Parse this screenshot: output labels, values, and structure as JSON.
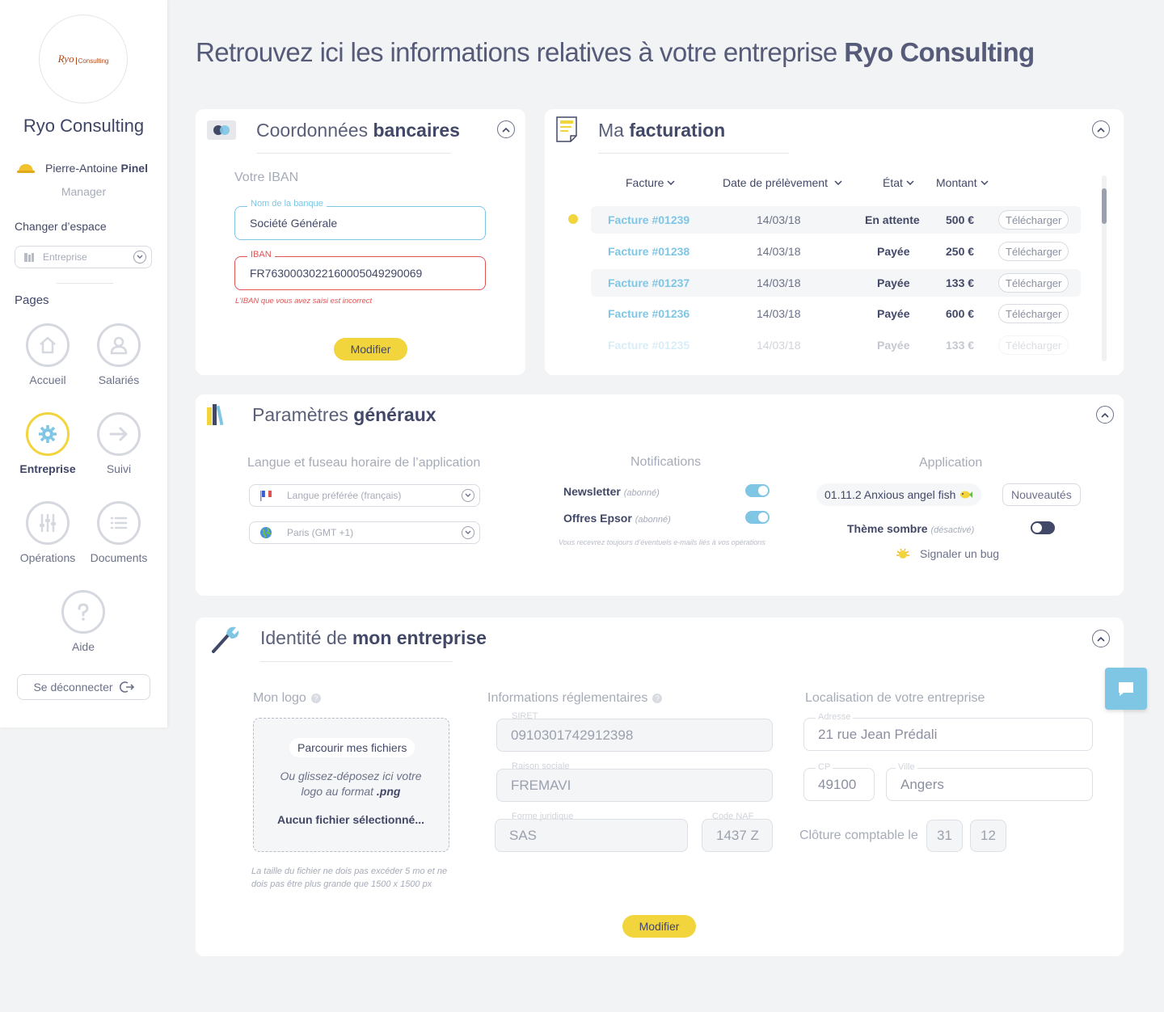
{
  "sidebar": {
    "logo": {
      "ryo": "Ryo",
      "consulting": "Consulting"
    },
    "company_name": "Ryo Consulting",
    "user": {
      "first_name": "Pierre-Antoine",
      "last_name": "Pinel",
      "role": "Manager"
    },
    "change_space_label": "Changer d’espace",
    "space_selected": "Entreprise",
    "pages_label": "Pages",
    "nav": [
      {
        "label": "Accueil",
        "icon": "home-icon"
      },
      {
        "label": "Salariés",
        "icon": "user-icon"
      },
      {
        "label": "Entreprise",
        "icon": "gear-icon",
        "active": true
      },
      {
        "label": "Suivi",
        "icon": "arrow-right-icon"
      },
      {
        "label": "Opérations",
        "icon": "sliders-icon"
      },
      {
        "label": "Documents",
        "icon": "list-icon"
      },
      {
        "label": "Aide",
        "icon": "question-icon"
      }
    ],
    "logout_label": "Se déconnecter"
  },
  "page": {
    "title_prefix": "Retrouvez ici les informations relatives à votre entreprise",
    "title_company": "Ryo Consulting"
  },
  "bank": {
    "title_light": "Coordonnées",
    "title_bold": "bancaires",
    "section_label": "Votre IBAN",
    "bank_name_label": "Nom de la banque",
    "bank_name_value": "Société Générale",
    "iban_label": "IBAN",
    "iban_value": "FR7630003022160005049290069",
    "iban_error": "L'IBAN que vous avez saisi est incorrect",
    "modify_label": "Modifier"
  },
  "billing": {
    "title_light": "Ma",
    "title_bold": "facturation",
    "headers": {
      "invoice": "Facture",
      "date": "Date de prélèvement",
      "state": "État",
      "amount": "Montant"
    },
    "rows": [
      {
        "invoice": "Facture #01239",
        "date": "14/03/18",
        "state": "En attente",
        "amount": "500 €",
        "download": "Télécharger"
      },
      {
        "invoice": "Facture #01238",
        "date": "14/03/18",
        "state": "Payée",
        "amount": "250 €",
        "download": "Télécharger"
      },
      {
        "invoice": "Facture #01237",
        "date": "14/03/18",
        "state": "Payée",
        "amount": "133 €",
        "download": "Télécharger"
      },
      {
        "invoice": "Facture #01236",
        "date": "14/03/18",
        "state": "Payée",
        "amount": "600 €",
        "download": "Télécharger"
      },
      {
        "invoice": "Facture #01235",
        "date": "14/03/18",
        "state": "Payée",
        "amount": "133 €",
        "download": "Télécharger"
      }
    ]
  },
  "params": {
    "title_light": "Paramètres",
    "title_bold": "généraux",
    "language_section": "Langue et fuseau horaire de l’application",
    "language_value": "Langue préférée (français)",
    "timezone_value": "Paris (GMT +1)",
    "notifications_section": "Notifications",
    "newsletter_label": "Newsletter",
    "newsletter_state": "(abonné)",
    "offers_label": "Offres Epsor",
    "offers_state": "(abonné)",
    "notifications_note": "Vous recevrez toujours d’éventuels e-mails liés à vos opérations",
    "application_section": "Application",
    "version": "01.11.2 Anxious angel fish",
    "news_label": "Nouveautés",
    "dark_theme_label": "Thème sombre",
    "dark_theme_state": "(désactivé)",
    "report_bug_label": "Signaler un bug"
  },
  "identity": {
    "title_light": "Identité de",
    "title_bold": "mon entreprise",
    "logo_section": "Mon logo",
    "browse_label": "Parcourir mes fichiers",
    "drop_text_1": "Ou glissez-déposez ici votre",
    "drop_text_2": "logo au format",
    "drop_format": ".png",
    "no_file": "Aucun fichier sélectionné...",
    "file_note_1": "La taille du fichier ne dois pas excéder 5 mo et ne",
    "file_note_2": "dois pas être plus grande que 1500 x 1500 px",
    "regulatory_section": "Informations réglementaires",
    "siret_label": "SIRET",
    "siret_value": "0910301742912398",
    "company_label": "Raison sociale",
    "company_value": "FREMAVI",
    "legal_form_label": "Forme juridique",
    "legal_form_value": "SAS",
    "naf_label": "Code NAF",
    "naf_value": "1437 Z",
    "location_section": "Localisation de votre entreprise",
    "address_label": "Adresse",
    "address_value": "21 rue Jean Prédali",
    "zip_label": "CP",
    "zip_value": "49100",
    "city_label": "Ville",
    "city_value": "Angers",
    "closing_label": "Clôture comptable le",
    "closing_day": "31",
    "closing_month": "12",
    "modify_label": "Modifier"
  },
  "colors": {
    "accent": "#f2d43c",
    "link": "#7fc6e5",
    "error": "#e05353",
    "text": "#424867"
  }
}
